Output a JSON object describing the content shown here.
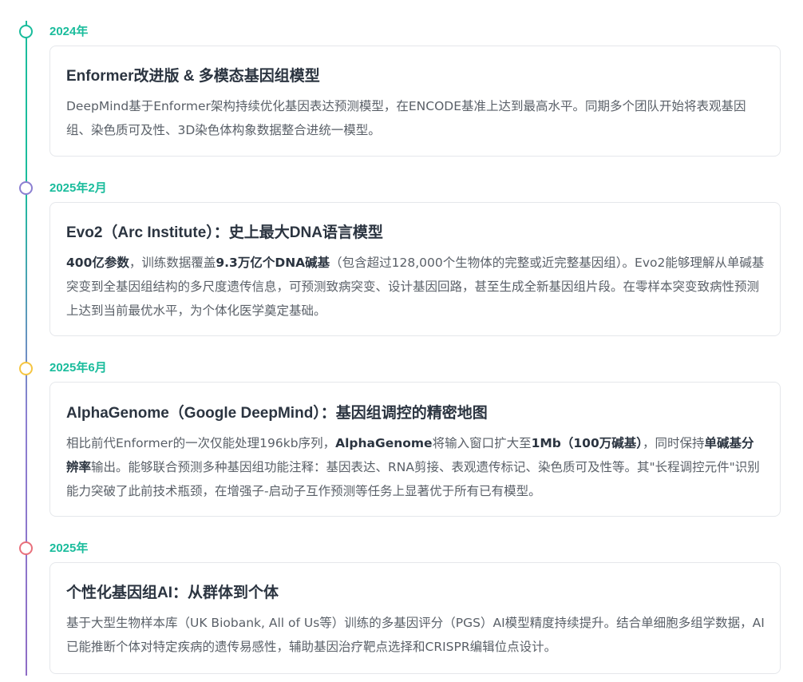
{
  "colors": {
    "accent": "#1abc9c",
    "line_bottom": "#8e6cc5",
    "title": "#2b3440",
    "text": "#5a6068",
    "border": "#e5e7eb"
  },
  "items": [
    {
      "date": "2024年",
      "dot_color": "#1abc9c",
      "title": "Enformer改进版 & 多模态基因组模型",
      "body": [
        {
          "text": "DeepMind基于Enformer架构持续优化基因表达预测模型，在ENCODE基准上达到最高水平。同期多个团队开始将表观基因组、染色质可及性、3D染色体构象数据整合进统一模型。",
          "bold": false
        }
      ]
    },
    {
      "date": "2025年2月",
      "dot_color": "#8b7fd1",
      "title": "Evo2（Arc Institute）：史上最大DNA语言模型",
      "body": [
        {
          "text": "400亿参数",
          "bold": true
        },
        {
          "text": "，训练数据覆盖",
          "bold": false
        },
        {
          "text": "9.3万亿个DNA碱基",
          "bold": true
        },
        {
          "text": "（包含超过128,000个生物体的完整或近完整基因组）。Evo2能够理解从单碱基突变到全基因组结构的多尺度遗传信息，可预测致病突变、设计基因回路，甚至生成全新基因组片段。在零样本突变致病性预测上达到当前最优水平，为个体化医学奠定基础。",
          "bold": false
        }
      ]
    },
    {
      "date": "2025年6月",
      "dot_color": "#f5c542",
      "title": "AlphaGenome（Google DeepMind）：基因组调控的精密地图",
      "body": [
        {
          "text": "相比前代Enformer的一次仅能处理196kb序列，",
          "bold": false
        },
        {
          "text": "AlphaGenome",
          "bold": true
        },
        {
          "text": "将输入窗口扩大至",
          "bold": false
        },
        {
          "text": "1Mb（100万碱基）",
          "bold": true
        },
        {
          "text": "，同时保持",
          "bold": false
        },
        {
          "text": "单碱基分辨率",
          "bold": true
        },
        {
          "text": "输出。能够联合预测多种基因组功能注释：基因表达、RNA剪接、表观遗传标记、染色质可及性等。其\"长程调控元件\"识别能力突破了此前技术瓶颈，在增强子-启动子互作预测等任务上显著优于所有已有模型。",
          "bold": false
        }
      ]
    },
    {
      "date": "2025年",
      "dot_color": "#e8707c",
      "title": "个性化基因组AI：从群体到个体",
      "body": [
        {
          "text": "基于大型生物样本库（UK Biobank, All of Us等）训练的多基因评分（PGS）AI模型精度持续提升。结合单细胞多组学数据，AI已能推断个体对特定疾病的遗传易感性，辅助基因治疗靶点选择和CRISPR编辑位点设计。",
          "bold": false
        }
      ]
    }
  ]
}
